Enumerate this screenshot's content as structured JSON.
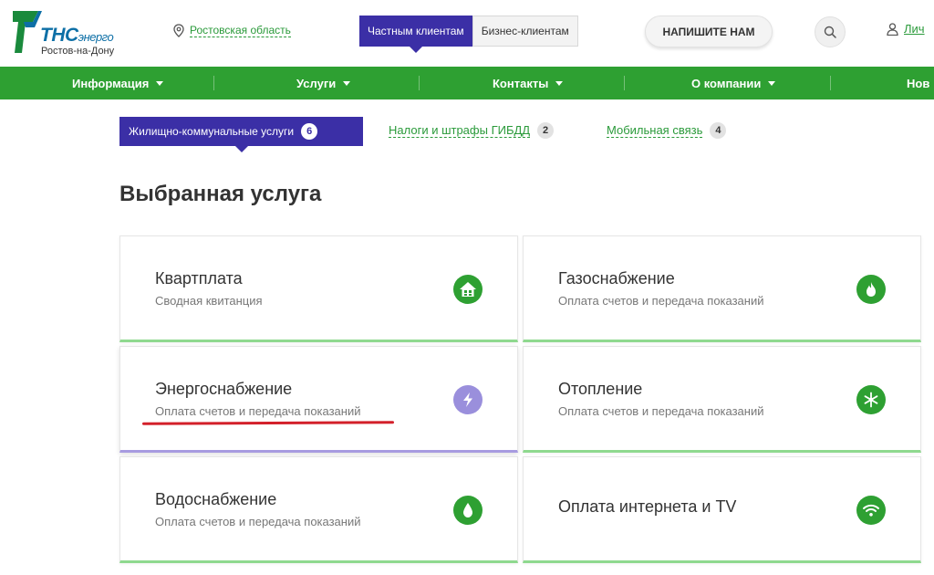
{
  "header": {
    "logo_title": "ТНС",
    "logo_title_small": "энерго",
    "logo_subtitle": "Ростов-на-Дону",
    "region": "Ростовская область",
    "segments": [
      "Частным клиентам",
      "Бизнес-клиентам"
    ],
    "write_button": "НАПИШИТЕ НАМ",
    "account_label": "Лич"
  },
  "nav": {
    "items": [
      "Информация",
      "Услуги",
      "Контакты",
      "О компании",
      "Нов"
    ]
  },
  "categories": [
    {
      "label": "Жилищно-коммунальные услуги",
      "count": "6"
    },
    {
      "label": "Налоги и штрафы ГИБДД",
      "count": "2"
    },
    {
      "label": "Мобильная связь",
      "count": "4"
    }
  ],
  "section_title": "Выбранная услуга",
  "services": [
    {
      "title": "Квартплата",
      "subtitle": "Сводная квитанция",
      "icon": "house-icon"
    },
    {
      "title": "Газоснабжение",
      "subtitle": "Оплата счетов и передача показаний",
      "icon": "flame-icon"
    },
    {
      "title": "Энергоснабжение",
      "subtitle": "Оплата счетов и передача показаний",
      "icon": "lightning-icon"
    },
    {
      "title": "Отопление",
      "subtitle": "Оплата счетов и передача показаний",
      "icon": "snowflake-icon"
    },
    {
      "title": "Водоснабжение",
      "subtitle": "Оплата счетов и передача показаний",
      "icon": "water-drop-icon"
    },
    {
      "title": "Оплата интернета и TV",
      "subtitle": "",
      "icon": "wifi-icon"
    }
  ],
  "colors": {
    "brand_green": "#2ea032",
    "accent_purple": "#3b2fa6",
    "highlight_red": "#d3202a"
  }
}
